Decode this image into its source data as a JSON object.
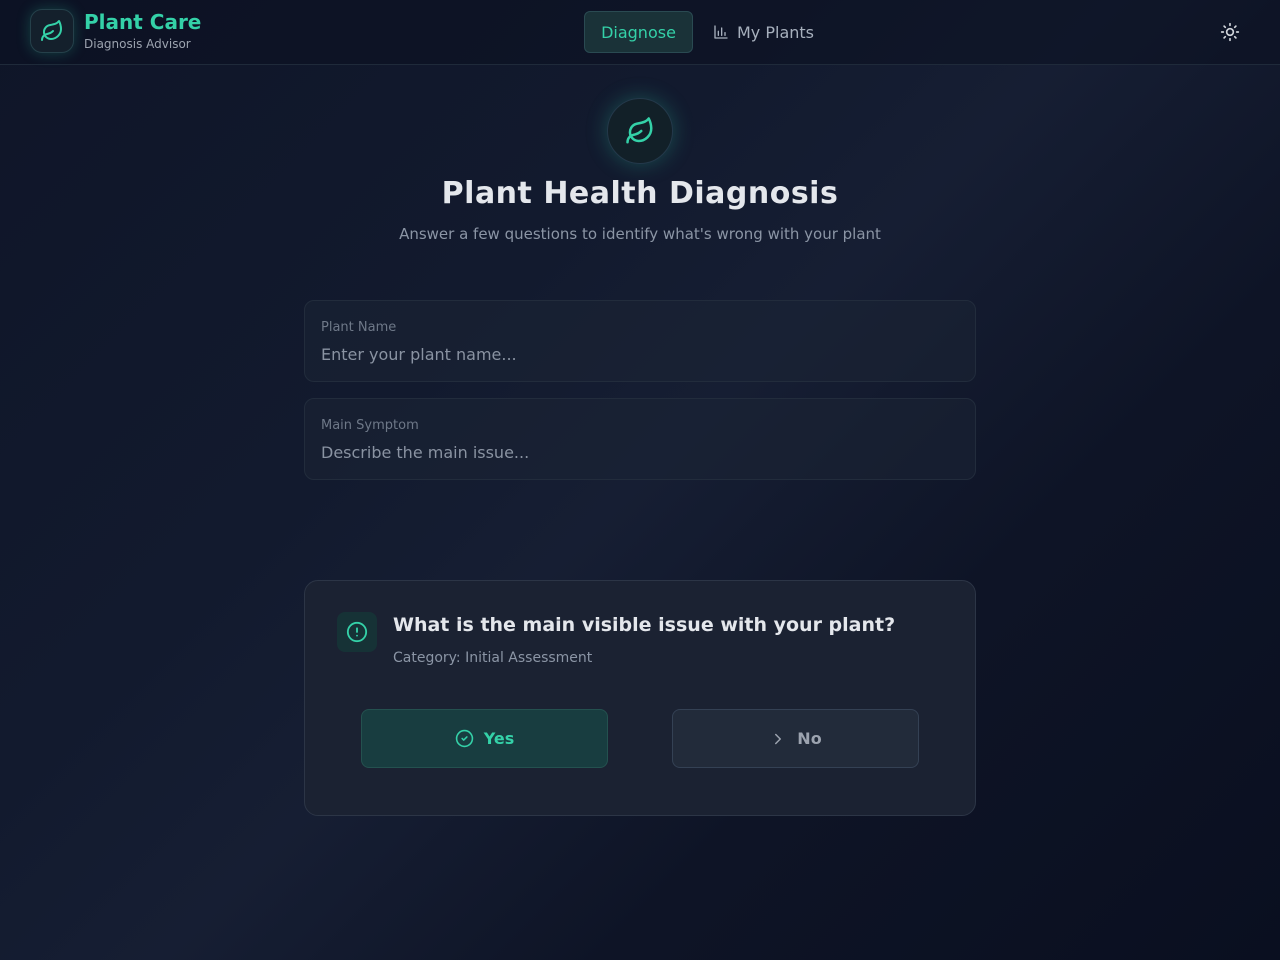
{
  "header": {
    "brand_title": "Plant Care",
    "brand_subtitle": "Diagnosis Advisor",
    "logo_icon": "leaf-icon",
    "nav": [
      {
        "label": "Diagnose",
        "active": true
      },
      {
        "label": "My Plants",
        "icon": "bar-chart-icon",
        "active": false
      }
    ],
    "theme_toggle_icon": "sun-icon"
  },
  "hero": {
    "icon": "leaf-icon",
    "title": "Plant Health Diagnosis",
    "subtitle": "Answer a few questions to identify what's wrong with your plant"
  },
  "form": {
    "plant_name": {
      "label": "Plant Name",
      "placeholder": "Enter your plant name...",
      "value": ""
    },
    "main_symptom": {
      "label": "Main Symptom",
      "placeholder": "Describe the main issue...",
      "value": ""
    }
  },
  "question": {
    "icon": "alert-circle-icon",
    "text": "What is the main visible issue with your plant?",
    "category": "Category: Initial Assessment",
    "yes_label": "Yes",
    "yes_icon": "check-circle-icon",
    "no_label": "No",
    "no_icon": "chevron-right-icon"
  },
  "colors": {
    "accent": "#34d1a8",
    "background": "#0f1528",
    "card": "#1b2232"
  }
}
